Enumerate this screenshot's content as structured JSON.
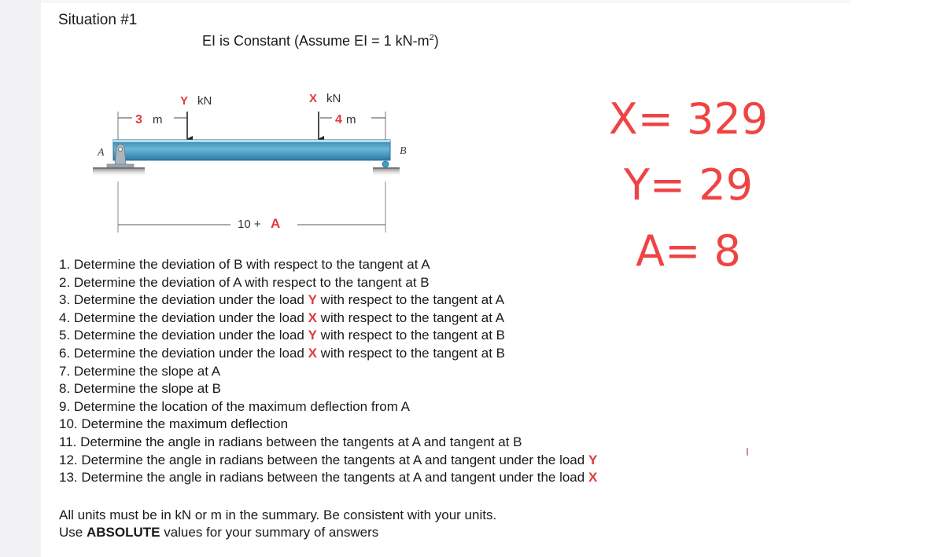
{
  "title": "Situation #1",
  "ei_note": {
    "text": "EI is Constant (Assume EI = 1 kN-m",
    "sup": "2",
    "close": ")"
  },
  "diagram": {
    "support_a_label": "A",
    "support_b_label": "B",
    "load_y": {
      "var": "Y",
      "unit": "kN"
    },
    "load_x": {
      "var": "X",
      "unit": "kN"
    },
    "dim_left": {
      "value": "3",
      "unit": "m"
    },
    "dim_right": {
      "value": "4",
      "unit": "m"
    },
    "span": {
      "prefix": "10 +",
      "var": "A"
    }
  },
  "answers": [
    {
      "text": "X= 329"
    },
    {
      "text": "Y= 29"
    },
    {
      "text": "A= 8"
    }
  ],
  "questions": [
    {
      "pre": "1. Determine the deviation of B with respect to the tangent at A",
      "hl": "",
      "post": ""
    },
    {
      "pre": "2. Determine the deviation of A with respect to the tangent at B",
      "hl": "",
      "post": ""
    },
    {
      "pre": "3. Determine the deviation under the load ",
      "hl": "Y",
      "post": " with respect to the tangent at A"
    },
    {
      "pre": "4. Determine the deviation under the load ",
      "hl": "X",
      "post": " with respect to the tangent at A"
    },
    {
      "pre": "5. Determine the deviation under the load ",
      "hl": "Y",
      "post": " with respect to the tangent at B"
    },
    {
      "pre": "6. Determine the deviation under the load ",
      "hl": "X",
      "post": " with respect to the tangent at B"
    },
    {
      "pre": "7. Determine the slope at A",
      "hl": "",
      "post": ""
    },
    {
      "pre": "8. Determine the slope at B",
      "hl": "",
      "post": ""
    },
    {
      "pre": "9. Determine the location of the maximum deflection from A",
      "hl": "",
      "post": ""
    },
    {
      "pre": "10. Determine the maximum deflection",
      "hl": "",
      "post": ""
    },
    {
      "pre": "11. Determine the angle in radians between the tangents at A and tangent at B",
      "hl": "",
      "post": ""
    },
    {
      "pre": "12. Determine the angle in radians between the tangents at A and tangent under the load ",
      "hl": "Y",
      "post": ""
    },
    {
      "pre": "13. Determine the angle in radians between the tangents at A and tangent under the load ",
      "hl": "X",
      "post": ""
    }
  ],
  "notes": {
    "line1": "All units must be in kN or m in the summary. Be consistent with your units.",
    "line2_pre": "Use ",
    "line2_bold": "ABSOLUTE",
    "line2_post": " values for your summary of answers"
  }
}
